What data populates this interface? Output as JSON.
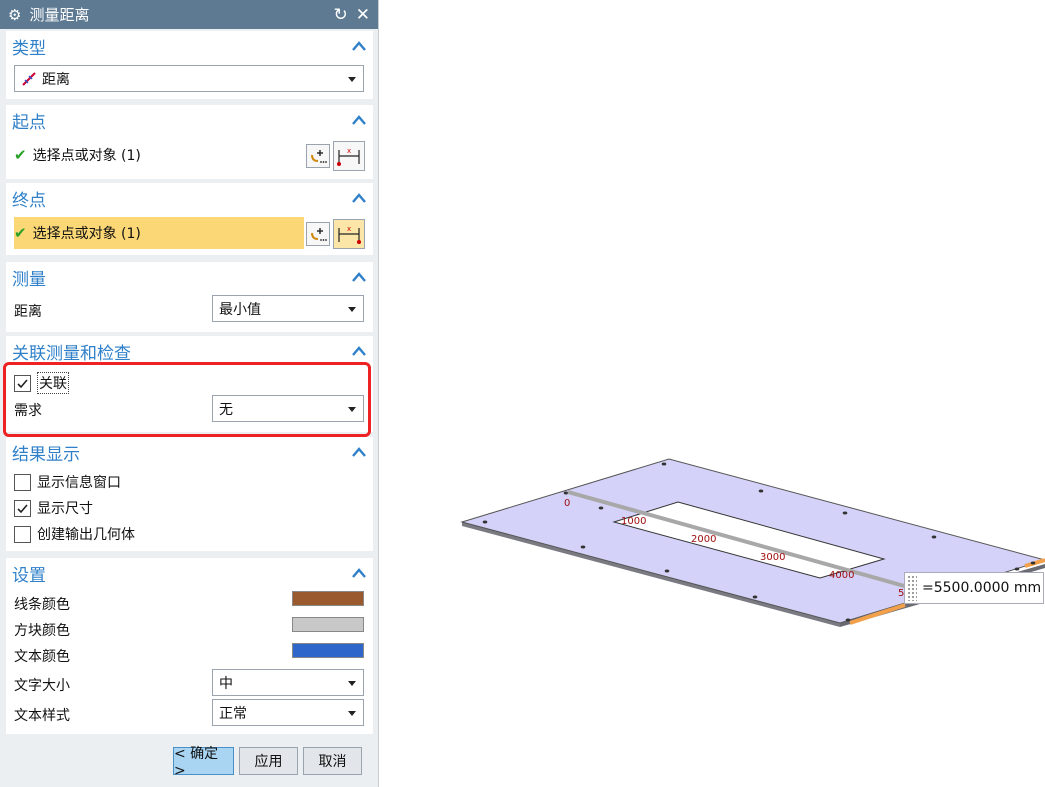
{
  "window": {
    "title": "测量距离",
    "settings_icon": "gear-icon",
    "reset_icon": "reset-icon",
    "close_icon": "close-icon"
  },
  "type_section": {
    "title": "类型",
    "selected": "距离",
    "icon": "distance-ruler-icon"
  },
  "start_section": {
    "title": "起点",
    "select_label": "选择点或对象 (1)"
  },
  "end_section": {
    "title": "终点",
    "select_label": "选择点或对象 (1)",
    "highlight_color": "#fbd776"
  },
  "measure_section": {
    "title": "测量",
    "distance_label": "距离",
    "distance_value": "最小值"
  },
  "assoc_section": {
    "title": "关联测量和检查",
    "associative_label": "关联",
    "associative_checked": true,
    "requirement_label": "需求",
    "requirement_value": "无"
  },
  "result_section": {
    "title": "结果显示",
    "show_info_label": "显示信息窗口",
    "show_info_checked": false,
    "show_dim_label": "显示尺寸",
    "show_dim_checked": true,
    "create_geom_label": "创建输出几何体",
    "create_geom_checked": false
  },
  "settings_section": {
    "title": "设置",
    "line_color_label": "线条颜色",
    "line_color": "#9a5a2e",
    "block_color_label": "方块颜色",
    "block_color": "#c8c8c8",
    "text_color_label": "文本颜色",
    "text_color": "#2f66c9",
    "text_size_label": "文字大小",
    "text_size_value": "中",
    "text_style_label": "文本样式",
    "text_style_value": "正常"
  },
  "buttons": {
    "ok": "< 确定 >",
    "apply": "应用",
    "cancel": "取消"
  },
  "viewport": {
    "plate_color": "#d4d2f8",
    "ruler_ticks": [
      "0",
      "1000",
      "2000",
      "3000",
      "4000",
      "5"
    ],
    "measurement": "=5500.0000 mm"
  },
  "accent_color": "#2f80c9",
  "annotation_color": "#ee2222"
}
